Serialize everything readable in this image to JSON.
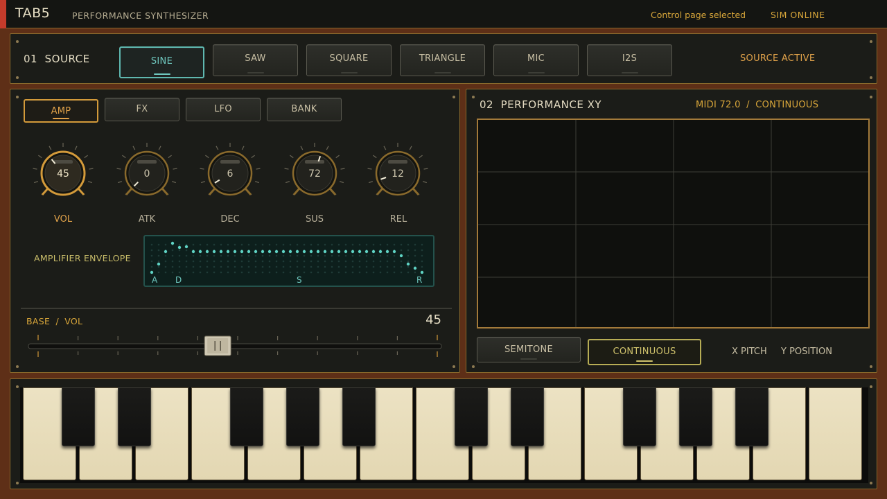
{
  "header": {
    "brand": "TAB5",
    "subtitle": "PERFORMANCE SYNTHESIZER",
    "status": "Control page selected",
    "online": "SIM  ONLINE"
  },
  "source": {
    "number": "01",
    "title": "SOURCE",
    "buttons": [
      "SINE",
      "SAW",
      "SQUARE",
      "TRIANGLE",
      "MIC",
      "I2S"
    ],
    "selected": "SINE",
    "status": "SOURCE ACTIVE"
  },
  "amp_panel": {
    "tabs": [
      "AMP",
      "FX",
      "LFO",
      "BANK"
    ],
    "selected_tab": "AMP",
    "knobs": [
      {
        "label": "VOL",
        "value": "45",
        "active": true
      },
      {
        "label": "ATK",
        "value": "0",
        "active": false
      },
      {
        "label": "DEC",
        "value": "6",
        "active": false
      },
      {
        "label": "SUS",
        "value": "72",
        "active": false
      },
      {
        "label": "REL",
        "value": "12",
        "active": false
      }
    ],
    "envelope_label": "AMPLIFIER ENVELOPE",
    "envelope_markers": [
      "A",
      "D",
      "S",
      "R"
    ],
    "slider_label_base": "BASE",
    "slider_label_sep": "/",
    "slider_label_param": "VOL",
    "slider_value": "45",
    "slider_level": 0.45
  },
  "xy_panel": {
    "number": "02",
    "title": "PERFORMANCE XY",
    "midi": "MIDI 72.0",
    "sep": "/",
    "mode": "CONTINUOUS",
    "mode_buttons": [
      "SEMITONE",
      "CONTINUOUS"
    ],
    "selected_mode": "CONTINUOUS",
    "x_label": "X PITCH",
    "y_label": "Y POSITION"
  },
  "colors": {
    "accent_gold": "#e0a24a",
    "accent_teal": "#6fc8bf",
    "accent_red": "#c43b2b",
    "panel_bg": "#1b1c18"
  }
}
